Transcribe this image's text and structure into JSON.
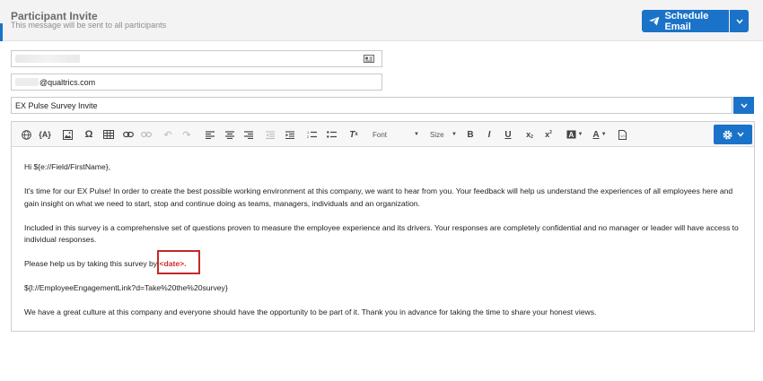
{
  "header": {
    "title": "Participant Invite",
    "subtitle": "This message will be sent to all participants",
    "schedule_button": "Schedule Email"
  },
  "fields": {
    "from_name_value": "",
    "from_email_suffix": "@qualtrics.com",
    "subject_value": "EX Pulse Survey Invite"
  },
  "toolbar": {
    "font_label": "Font",
    "size_label": "Size",
    "bold": "B",
    "italic": "I",
    "underline": "U"
  },
  "body": {
    "greeting": "Hi ${e://Field/FirstName},",
    "para1": "It's time for our EX Pulse! In order to create the best possible working environment at this company, we want to hear from you.  Your feedback will help us understand the experiences of all employees here and gain insight on what we need to start, stop and continue doing as teams, managers, individuals and an organization.",
    "para2": "Included in this survey is a comprehensive set of questions proven to measure the employee experience and its drivers. Your responses are completely confidential and no manager or leader will have access to individual responses.",
    "para3_prefix": "Please help us by taking this survey by ",
    "para3_date": "<date>",
    "para3_suffix": ".",
    "link": "${l://EmployeeEngagementLink?d=Take%20the%20survey}",
    "closing": "We have a great culture at this company and everyone should have the opportunity to be part of it.  Thank you in advance for taking the time to share your honest views."
  },
  "colors": {
    "accent": "#1a73c8",
    "highlight": "#c62828",
    "date_text": "#d42a2a"
  }
}
